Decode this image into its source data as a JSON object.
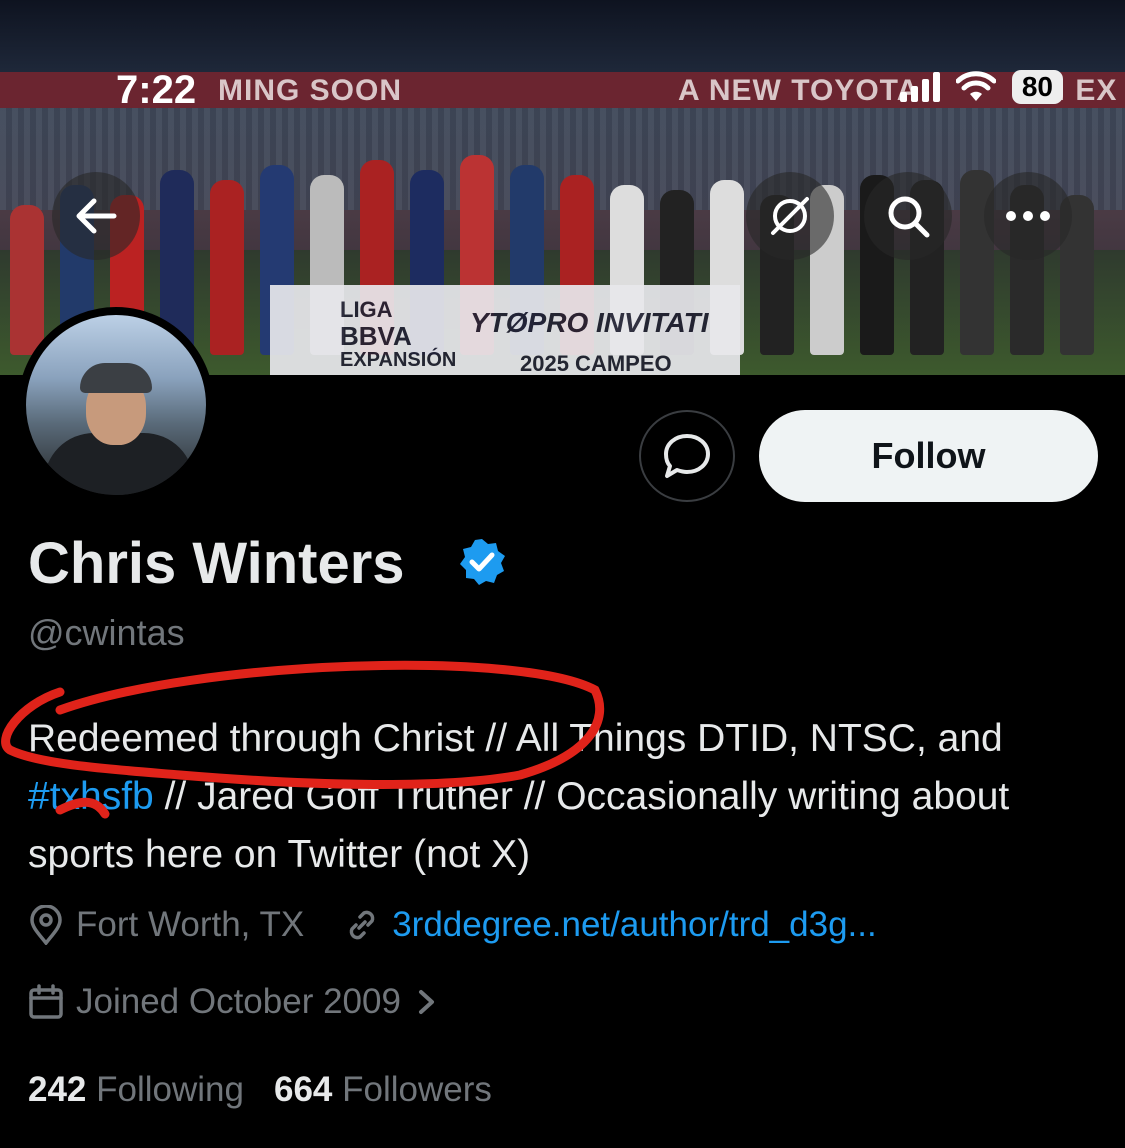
{
  "status_bar": {
    "time": "7:22",
    "battery": "80"
  },
  "banner": {
    "stripe_left": "MING SOON",
    "stripe_right": "A NEW TOYOTA",
    "stripe_far": "M EX",
    "board_left_1": "LIGA",
    "board_left_2": "BBVA",
    "board_left_3": "EXPANSIÓN",
    "board_right": "YTØPRO INVITATI",
    "board_bottom": "2025 CAMPEO"
  },
  "actions": {
    "follow_label": "Follow"
  },
  "profile": {
    "name": "Chris Winters",
    "handle": "@cwintas",
    "bio_part1": "Redeemed through Christ // All Things DTID, NTSC, and",
    "bio_hashtag": "#txhsfb",
    "bio_part2": " // Jared Goff Truther // Occasionally writing about sports here on Twitter (not X)",
    "location": "Fort Worth, TX",
    "website": "3rddegree.net/author/trd_d3g...",
    "joined": "Joined October 2009",
    "following_count": "242",
    "following_label": "Following",
    "followers_count": "664",
    "followers_label": "Followers"
  },
  "colors": {
    "accent": "#1d9bf0",
    "annotation": "#e0231a"
  }
}
